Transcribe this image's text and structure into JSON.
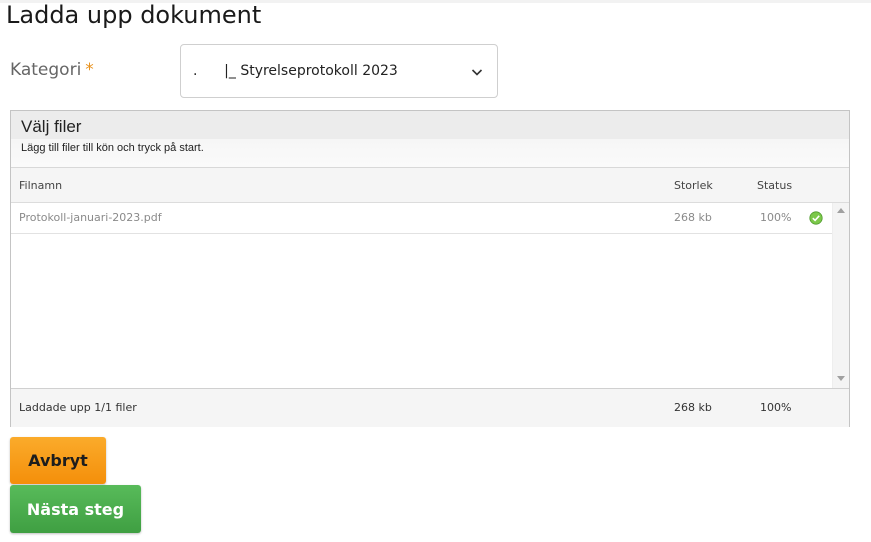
{
  "page": {
    "title": "Ladda upp dokument"
  },
  "form": {
    "category_label": "Kategori",
    "required_mark": "*",
    "category_value": ".      |_ Styrelseprotokoll 2023"
  },
  "uploader": {
    "title": "Välj filer",
    "subtitle": "Lägg till filer till kön och tryck på start.",
    "columns": {
      "name": "Filnamn",
      "size": "Storlek",
      "status": "Status"
    },
    "files": [
      {
        "name": "Protokoll-januari-2023.pdf",
        "size": "268 kb",
        "status": "100%",
        "icon": "check-circle-icon"
      }
    ],
    "footer": {
      "summary": "Laddade upp 1/1 filer",
      "total_size": "268 kb",
      "total_status": "100%"
    }
  },
  "buttons": {
    "cancel": "Avbryt",
    "next": "Nästa steg"
  },
  "colors": {
    "cancel_bg": "#f7a01c",
    "next_bg": "#4cae4f",
    "star": "#e8901b",
    "ok_icon": "#6cbf3a"
  }
}
